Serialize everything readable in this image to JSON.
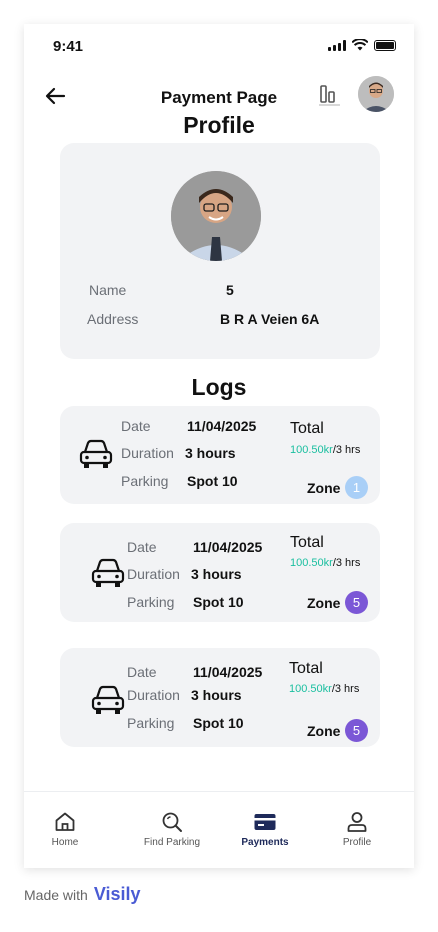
{
  "status_bar": {
    "time": "9:41"
  },
  "header": {
    "title": "Payment Page"
  },
  "profile": {
    "section_title": "Profile",
    "name_label": "Name",
    "name_value": "5",
    "address_label": "Address",
    "address_value": "B R A Veien 6A"
  },
  "logs": {
    "section_title": "Logs",
    "entries": [
      {
        "date_label": "Date",
        "date": "11/04/2025",
        "duration_label": "Duration",
        "duration": "3 hours",
        "parking_label": "Parking",
        "parking": "Spot 10",
        "total_label": "Total",
        "price_amount": "100.50kr",
        "price_suffix": "/3 hrs",
        "zone_label": "Zone",
        "zone": "1",
        "zone_color": "#a9cff7"
      },
      {
        "date_label": "Date",
        "date": "11/04/2025",
        "duration_label": "Duration",
        "duration": "3 hours",
        "parking_label": "Parking",
        "parking": "Spot 10",
        "total_label": "Total",
        "price_amount": "100.50kr",
        "price_suffix": "/3 hrs",
        "zone_label": "Zone",
        "zone": "5",
        "zone_color": "#7b57d6"
      },
      {
        "date_label": "Date",
        "date": "11/04/2025",
        "duration_label": "Duration",
        "duration": "3 hours",
        "parking_label": "Parking",
        "parking": "Spot 10",
        "total_label": "Total",
        "price_amount": "100.50kr",
        "price_suffix": "/3 hrs",
        "zone_label": "Zone",
        "zone": "5",
        "zone_color": "#7b57d6"
      }
    ]
  },
  "nav": {
    "items": [
      {
        "label": "Home",
        "icon": "home-icon"
      },
      {
        "label": "Find Parking",
        "icon": "search-icon"
      },
      {
        "label": "Payments",
        "icon": "card-icon",
        "active": true
      },
      {
        "label": "Profile",
        "icon": "user-icon"
      }
    ]
  },
  "footer": {
    "made_with": "Made with",
    "brand": "Visily"
  },
  "colors": {
    "accent_teal": "#1bbfa0",
    "card_bg": "#f2f3f5",
    "active_nav": "#1e2a5a"
  }
}
